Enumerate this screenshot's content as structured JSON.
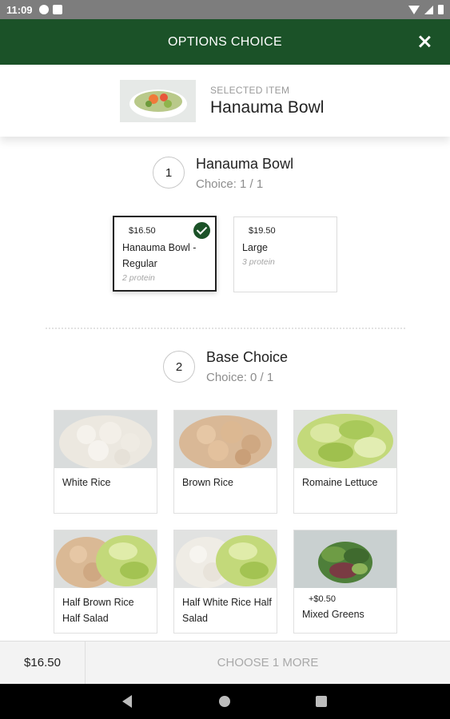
{
  "status_bar": {
    "time": "11:09",
    "icons": [
      "notification-icon",
      "sd-card-icon",
      "wifi-icon",
      "signal-icon",
      "battery-icon"
    ]
  },
  "header": {
    "title": "OPTIONS CHOICE",
    "close_icon": "close-icon"
  },
  "selected_item": {
    "label": "SELECTED ITEM",
    "name": "Hanauma Bowl"
  },
  "sections": [
    {
      "number": "1",
      "title": "Hanauma Bowl",
      "choice": "Choice: 1 / 1",
      "options": [
        {
          "price": "$16.50",
          "name": "Hanauma Bowl - Regular",
          "sub": "2 protein",
          "selected": true
        },
        {
          "price": "$19.50",
          "name": "Large",
          "sub": "3 protein",
          "selected": false
        }
      ]
    },
    {
      "number": "2",
      "title": "Base Choice",
      "choice": "Choice: 0 / 1",
      "options": [
        {
          "name": "White Rice",
          "price": ""
        },
        {
          "name": "Brown Rice",
          "price": ""
        },
        {
          "name": "Romaine Lettuce",
          "price": ""
        },
        {
          "name": "Half Brown Rice Half Salad",
          "price": ""
        },
        {
          "name": "Half White Rice Half Salad",
          "price": ""
        },
        {
          "name": "Mixed Greens",
          "price": "+$0.50"
        }
      ]
    }
  ],
  "footer": {
    "total": "$16.50",
    "button_label": "CHOOSE 1 MORE"
  },
  "nav": {
    "back": "back-icon",
    "home": "home-icon",
    "recents": "recents-icon"
  },
  "colors": {
    "brand_green": "#1b5228",
    "status_bar": "#7d7d7d",
    "muted_text": "#8d8d8d"
  }
}
